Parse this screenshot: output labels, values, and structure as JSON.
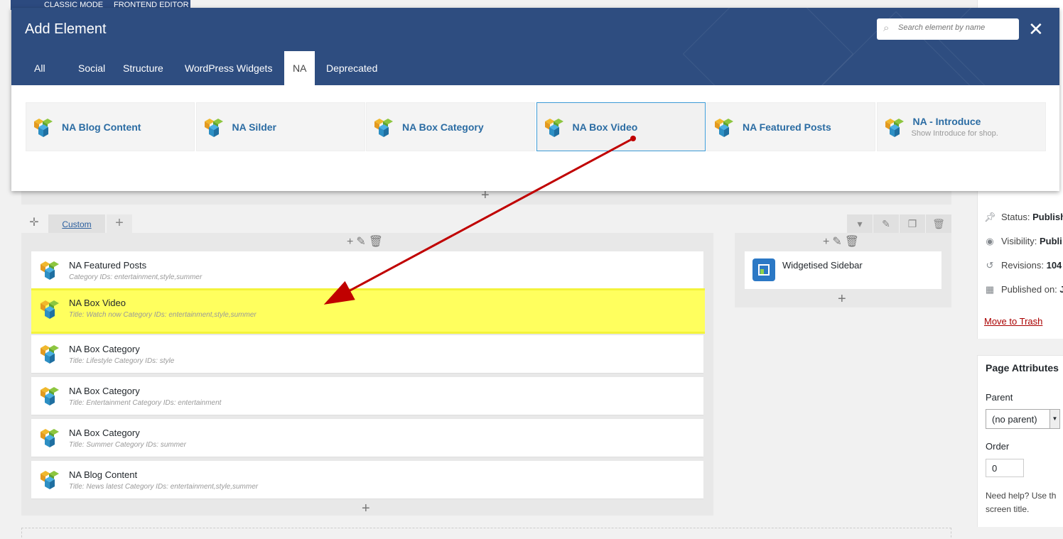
{
  "topbar": {
    "classic": "CLASSIC MODE",
    "frontend": "FRONTEND EDITOR"
  },
  "modal": {
    "title": "Add Element",
    "search_placeholder": "Search element by name",
    "tabs": [
      "All",
      "Social",
      "Structure",
      "WordPress Widgets",
      "NA",
      "Deprecated"
    ],
    "active_tab": "NA",
    "cards": [
      {
        "name": "NA Blog Content"
      },
      {
        "name": "NA Silder"
      },
      {
        "name": "NA Box Category"
      },
      {
        "name": "NA Box Video",
        "selected": true
      },
      {
        "name": "NA Featured Posts"
      },
      {
        "name": "NA - Introduce",
        "sub": "Show Introduce for shop."
      }
    ]
  },
  "row": {
    "custom_label": "Custom"
  },
  "left_column": {
    "elements": [
      {
        "name": "NA Featured Posts",
        "desc": "Category IDs: entertainment,style,summer"
      },
      {
        "name": "NA Box Video",
        "desc": "Title: Watch now  Category IDs: entertainment,style,summer",
        "highlighted": true
      },
      {
        "name": "NA Box Category",
        "desc": "Title: Lifestyle  Category IDs: style"
      },
      {
        "name": "NA Box Category",
        "desc": "Title: Entertainment  Category IDs: entertainment"
      },
      {
        "name": "NA Box Category",
        "desc": "Title: Summer  Category IDs: summer"
      },
      {
        "name": "NA Blog Content",
        "desc": "Title: News latest  Category IDs: entertainment,style,summer"
      }
    ]
  },
  "right_column": {
    "widget": "Widgetised Sidebar"
  },
  "publish": {
    "status_label": "Status:",
    "status_value": "Publish",
    "visibility_label": "Visibility:",
    "visibility_value": "Publi",
    "revisions_label": "Revisions:",
    "revisions_value": "104",
    "published_label": "Published on:",
    "published_value": "J",
    "trash": "Move to Trash"
  },
  "page_attributes": {
    "title": "Page Attributes",
    "parent_label": "Parent",
    "parent_value": "(no parent)",
    "order_label": "Order",
    "order_value": "0",
    "help_line1": "Need help? Use th",
    "help_line2": "screen title."
  },
  "colors": {
    "modal_header": "#2e4d80",
    "link": "#2b6ca3",
    "highlight": "#ffff5e",
    "arrow": "#c00000",
    "trash": "#aa0000"
  }
}
